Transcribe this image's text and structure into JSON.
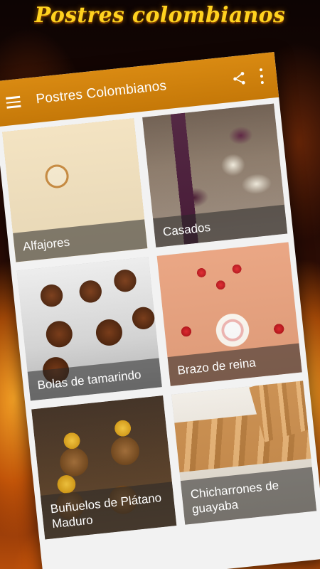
{
  "promo": {
    "headline": "Postres colombianos"
  },
  "app_bar": {
    "title": "Postres Colombianos",
    "menu_icon": "hamburger-menu-icon",
    "share_icon": "share-icon",
    "more_icon": "more-vertical-icon",
    "accent_color": "#d08513"
  },
  "grid": {
    "items": [
      {
        "label": "Alfajores"
      },
      {
        "label": "Casados"
      },
      {
        "label": "Bolas de tamarindo"
      },
      {
        "label": "Brazo de reina"
      },
      {
        "label": "Buñuelos de Plátano Maduro"
      },
      {
        "label": "Chicharrones de guayaba"
      }
    ]
  }
}
